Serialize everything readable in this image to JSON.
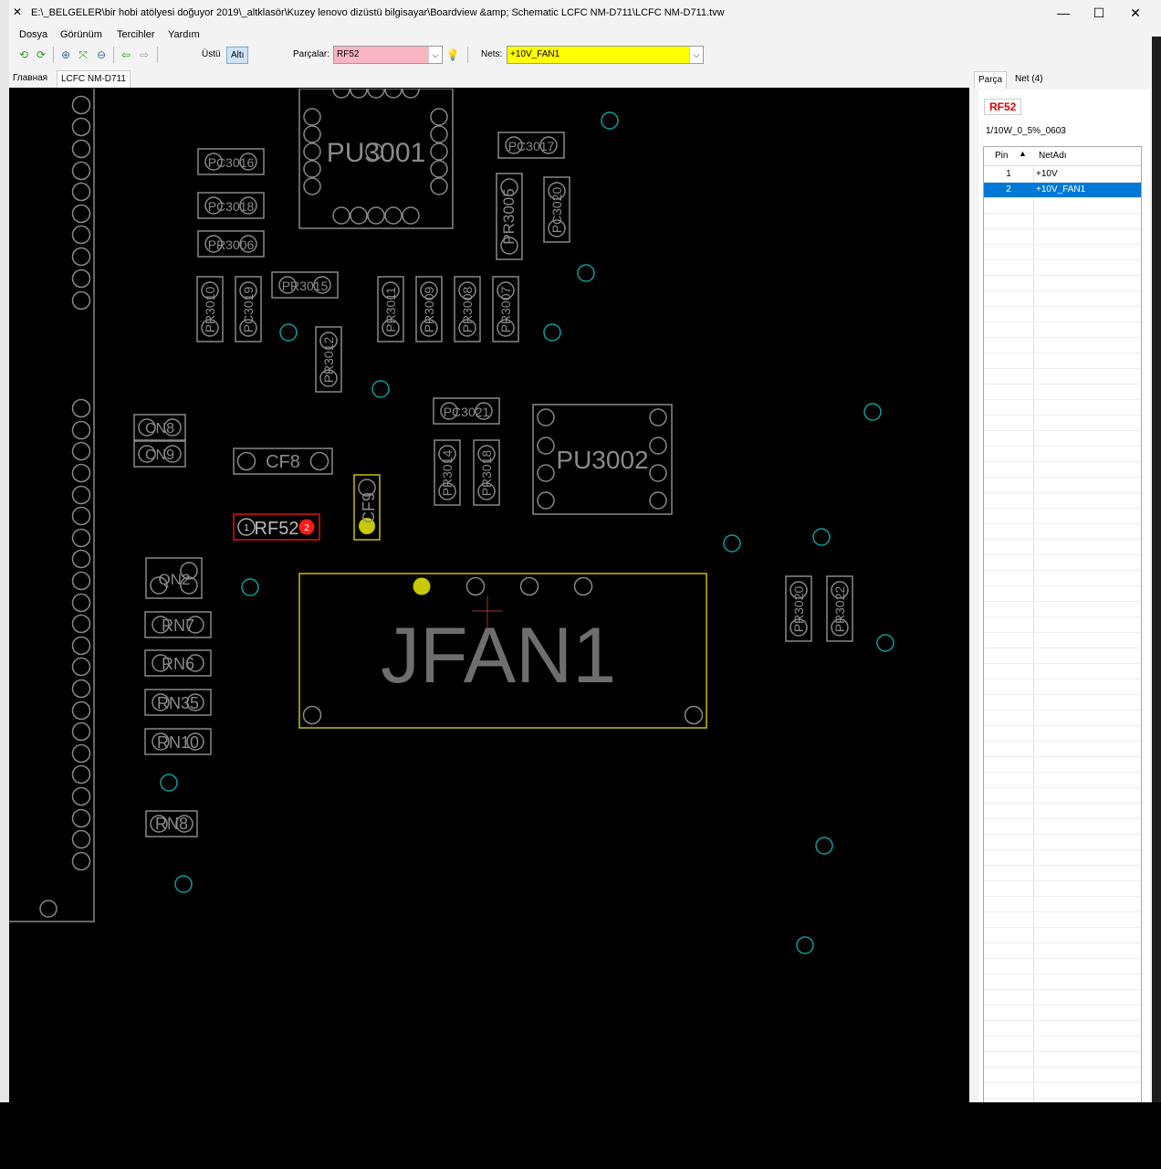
{
  "window": {
    "title": "E:\\_BELGELER\\bir hobi atölyesi doğuyor 2019\\_altklasör\\Kuzey lenovo dizüstü bilgisayar\\Boardview &amp; Schematic LCFC NM-D711\\LCFC NM-D711.tvw",
    "min": "—",
    "max": "☐",
    "close": "✕"
  },
  "menu": [
    "Dosya",
    "Görünüm",
    "Tercihler",
    "Yardım"
  ],
  "toolbar": {
    "side_top": "Üstü",
    "side_bottom": "Altı",
    "parts_label": "Parçalar:",
    "parts_value": "RF52",
    "nets_label": "Nets:",
    "nets_value": "+10V_FAN1",
    "parts_color": "#f7b6c2",
    "nets_color": "#ffff00"
  },
  "tabs": [
    "Главная",
    "LCFC NM-D711"
  ],
  "right_panel": {
    "tabs": [
      "Parça",
      "Net (4)"
    ],
    "part_name": "RF52",
    "package": "1/10W_0_5%_0603",
    "columns": [
      "Pin",
      "NetAdı"
    ],
    "rows": [
      {
        "pin": "1",
        "net": "+10V"
      },
      {
        "pin": "2",
        "net": "+10V_FAN1"
      }
    ]
  },
  "board": {
    "components": [
      "PU3001",
      "PC3016",
      "PC3018",
      "PR3006",
      "PC3017",
      "PR3005",
      "PC3020",
      "PR3010",
      "PC3019",
      "PR3015",
      "PR3011",
      "PR3009",
      "PR3008",
      "PR3007",
      "PR3012",
      "PC3021",
      "PU3002",
      "CN8",
      "CN9",
      "CF8",
      "PR3014",
      "PR3018",
      "RF52",
      "CF9",
      "QN2",
      "JFAN1",
      "PR3020",
      "PR3022",
      "RN7",
      "RN6",
      "RN35",
      "RN10",
      "RN8"
    ],
    "pin_labels": [
      "1",
      "2"
    ]
  }
}
